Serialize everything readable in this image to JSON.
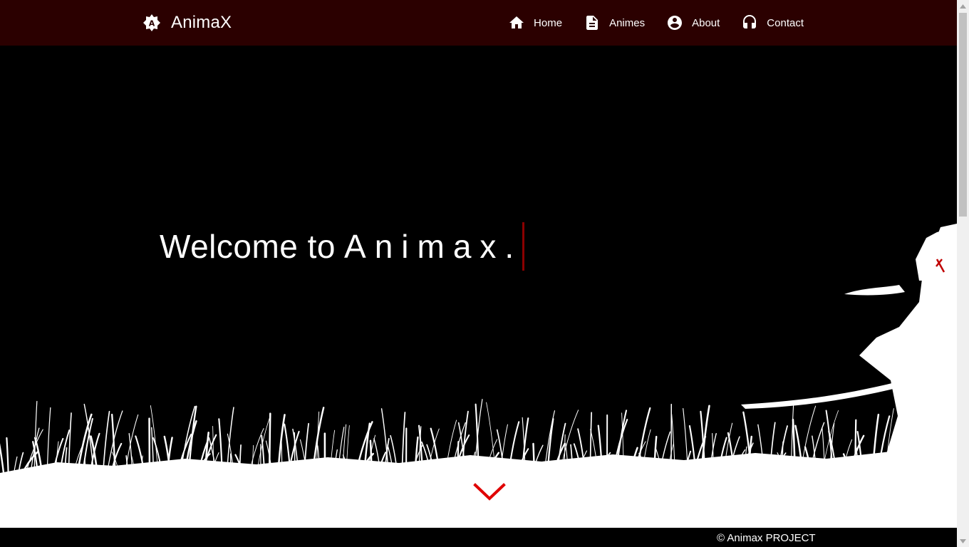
{
  "brand": {
    "name": "AnimaX",
    "icon": "anime-badge-icon"
  },
  "nav": {
    "items": [
      {
        "label": "Home",
        "icon": "home-icon"
      },
      {
        "label": "Animes",
        "icon": "document-icon"
      },
      {
        "label": "About",
        "icon": "account-circle-icon"
      },
      {
        "label": "Contact",
        "icon": "headset-icon"
      }
    ]
  },
  "hero": {
    "welcome_prefix": "Welcome to",
    "welcome_typed": "Animax.",
    "scroll_icon": "chevron-down-icon"
  },
  "footer": {
    "copyright": "© Animax PROJECT"
  },
  "colors": {
    "navbar_bg": "#2b0000",
    "accent_red": "#e00000",
    "caret": "#8b0000",
    "background": "#000000"
  }
}
